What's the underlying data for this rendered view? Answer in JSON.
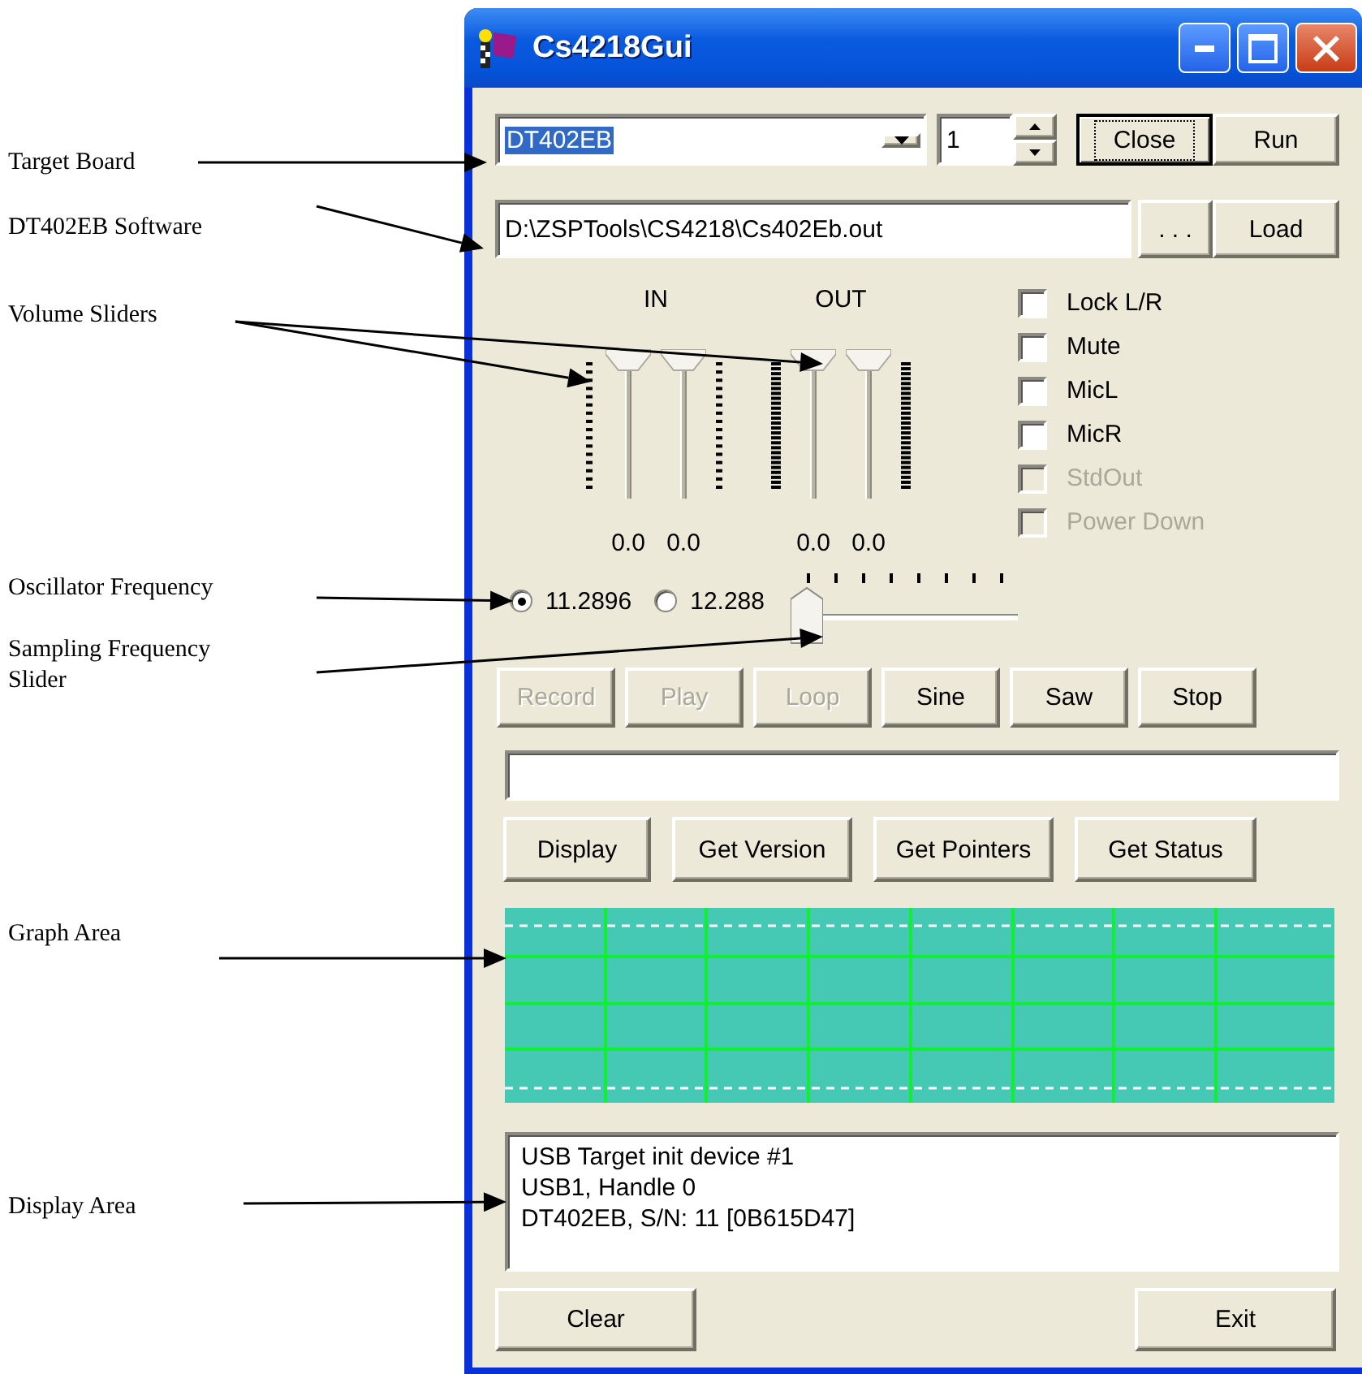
{
  "callouts": [
    {
      "label": "Target Board"
    },
    {
      "label": "DT402EB Software"
    },
    {
      "label": "Volume Sliders"
    },
    {
      "label": "Oscillator Frequency"
    },
    {
      "label": "Sampling Frequency Slider"
    },
    {
      "label": "Graph Area"
    },
    {
      "label": "Display Area"
    }
  ],
  "window": {
    "title": "Cs4218Gui"
  },
  "target": {
    "board": {
      "value": "DT402EB",
      "highlighted": true
    },
    "device": {
      "value": "1"
    },
    "buttons": [
      {
        "label": "Close",
        "focused": true
      },
      {
        "label": "Run",
        "focused": false
      }
    ]
  },
  "software": {
    "path": "D:\\ZSPTools\\CS4218\\Cs402Eb.out",
    "buttons": [
      {
        "label": ". . ."
      },
      {
        "label": "Load"
      }
    ]
  },
  "volume": {
    "groups": [
      {
        "label": "IN",
        "kind": "fine",
        "sliders": [
          {
            "level": 1,
            "value": "0.0"
          },
          {
            "level": 1,
            "value": "0.0"
          }
        ]
      },
      {
        "label": "OUT",
        "kind": "coarse",
        "sliders": [
          {
            "level": 1,
            "value": "0.0"
          },
          {
            "level": 1,
            "value": "0.0"
          }
        ]
      }
    ]
  },
  "options": [
    {
      "label": "Lock L/R",
      "checked": false,
      "disabled": false
    },
    {
      "label": "Mute",
      "checked": false,
      "disabled": false
    },
    {
      "label": "MicL",
      "checked": false,
      "disabled": false
    },
    {
      "label": "MicR",
      "checked": false,
      "disabled": false
    },
    {
      "label": "StdOut",
      "checked": false,
      "disabled": true
    },
    {
      "label": "Power Down",
      "checked": false,
      "disabled": true
    }
  ],
  "oscillator": [
    {
      "label": "11.2896",
      "selected": true
    },
    {
      "label": "12.288",
      "selected": false
    }
  ],
  "sampling_slider": {
    "level": 0
  },
  "playback_buttons": [
    {
      "label": "Record",
      "disabled": true
    },
    {
      "label": "Play",
      "disabled": true
    },
    {
      "label": "Loop",
      "disabled": true
    },
    {
      "label": "Sine",
      "disabled": false
    },
    {
      "label": "Saw",
      "disabled": false
    },
    {
      "label": "Stop",
      "disabled": false
    }
  ],
  "query_buttons": [
    {
      "label": "Display"
    },
    {
      "label": "Get Version"
    },
    {
      "label": "Get Pointers"
    },
    {
      "label": "Get Status"
    }
  ],
  "display_area": {
    "lines": [
      "USB Target init device #1",
      "USB1, Handle 0",
      "DT402EB, S/N: 11 [0B615D47]"
    ]
  },
  "footer_buttons": [
    {
      "label": "Clear"
    },
    {
      "label": "Exit"
    }
  ]
}
